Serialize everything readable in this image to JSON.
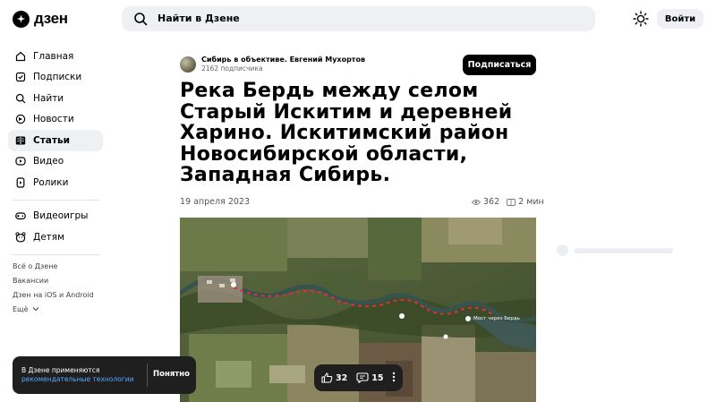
{
  "header": {
    "logo_text": "дзен",
    "search_placeholder": "Найти в Дзене",
    "login_label": "Войти"
  },
  "sidebar": {
    "items": [
      {
        "label": "Главная",
        "icon": "home-icon"
      },
      {
        "label": "Подписки",
        "icon": "subscriptions-icon"
      },
      {
        "label": "Найти",
        "icon": "search-icon"
      },
      {
        "label": "Новости",
        "icon": "news-icon"
      },
      {
        "label": "Статьи",
        "icon": "articles-icon"
      },
      {
        "label": "Видео",
        "icon": "video-icon"
      },
      {
        "label": "Ролики",
        "icon": "shorts-icon"
      }
    ],
    "extra_items": [
      {
        "label": "Видеоигры",
        "icon": "gamepad-icon"
      },
      {
        "label": "Детям",
        "icon": "kids-icon"
      }
    ],
    "footer_links": [
      "Всё о Дзене",
      "Вакансии",
      "Дзен на iOS и Android",
      "Ещё"
    ]
  },
  "article": {
    "channel_name": "Сибирь в объективе. Евгений Мухортов",
    "channel_subscribers": "2162 подписчика",
    "subscribe_label": "Подписаться",
    "title": "Река Бердь между селом Старый Искитим и деревней Харино. Искитимский район Новосибирской области, Западная Сибирь.",
    "date": "19 апреля 2023",
    "views": "362",
    "read_time": "2 мин"
  },
  "map": {
    "label_right": "Мост через Бердь"
  },
  "reactions": {
    "likes": "32",
    "comments": "15"
  },
  "cookie": {
    "text": "В Дзене применяются",
    "link": "рекомендательные технологии",
    "ok_label": "Понятно"
  },
  "colors": {
    "accent_bg": "#eef0f3",
    "link": "#5aa7ff",
    "route": "#e03030"
  }
}
